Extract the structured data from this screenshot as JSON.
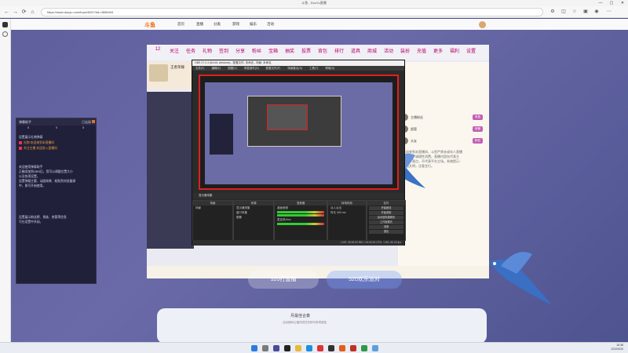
{
  "browser": {
    "window_title": "斗鱼 - DouYu直播",
    "address": "https://www.douyu.com/topic/520/?rid=4608494",
    "nav": {
      "back": "←",
      "forward": "→",
      "reload": "⟳",
      "home": "⌂"
    },
    "window_controls": {
      "min": "—",
      "max": "▢",
      "close": "✕"
    }
  },
  "site": {
    "logo": "斗鱼",
    "nav_items": [
      "首页",
      "直播",
      "分类",
      "游戏",
      "娱乐",
      "活动"
    ],
    "room": {
      "streamer_name": "王者荣耀",
      "room_toolbar": [
        "12",
        "关注",
        "任务",
        "礼物",
        "签到",
        "分享",
        "粉丝",
        "宝箱",
        "抽奖",
        "投票",
        "背包",
        "排行",
        "道具",
        "商城",
        "活动",
        "装扮",
        "充值",
        "更多",
        "福利",
        "设置"
      ],
      "chat_users": [
        {
          "name": "主播粉丝",
          "badge": "贵族"
        },
        {
          "name": "超管",
          "badge": "房管"
        },
        {
          "name": "水友",
          "badge": "粉丝"
        }
      ],
      "chat_text": [
        "欢迎来到本直播间，斗鱼严禁未成年人直播",
        "或打赏，请理性消费。直播内容仅代表主",
        "播个人观点，不代表平台立场。系统提示：",
        "网络文明，注意言行。"
      ]
    },
    "tabs": {
      "tab1": "520打直播",
      "tab2": "520欢乐派对"
    },
    "event": {
      "title": "月最佳合奏",
      "subtitle": "活动期间主播完成任务即可获得奖励"
    }
  },
  "obs": {
    "title": "OBS 27.2.4 (64-bit, windows) - 配置文件: 未命名 - 场景: 未命名",
    "menu": [
      "文件(F)",
      "编辑(E)",
      "视图(V)",
      "停靠部件(D)",
      "配置文件(P)",
      "场景集合(S)",
      "工具(T)",
      "帮助(H)"
    ],
    "scene_bar": "显示器采集",
    "docks": {
      "scenes": {
        "head": "场景",
        "items": [
          "场景"
        ]
      },
      "sources": {
        "head": "来源",
        "items": [
          "显示器采集",
          "窗口采集",
          "图像"
        ]
      },
      "mixer": {
        "head": "混音器",
        "items": [
          "桌面音频",
          "麦克风/Aux"
        ]
      },
      "transitions": {
        "head": "转场特效",
        "items": [
          "淡入淡出",
          "时长 300 ms"
        ]
      },
      "controls": {
        "head": "控件",
        "items": [
          "开始推流",
          "开始录制",
          "启动虚拟摄像机",
          "工作室模式",
          "设置",
          "退出"
        ]
      }
    },
    "status": "LIVE: 00:00:00   REC: 00:00:00   CPU: 1.8%, 60.00 fps"
  },
  "overlay_panel": {
    "title": "弹幕助手",
    "right": "已连接",
    "stats": [
      "0",
      "0",
      "0"
    ],
    "messages": [
      "设置展示礼物弹幕",
      "礼物 欢迎来到本直播间",
      "关注主播 欢迎进入直播间",
      "欢迎使用弹幕助手",
      "正确添加到OBS后，您可以调整位置大小",
      "以及各项设置。",
      "设置弹幕主题、动画效果、粘贴到浏览器源",
      "中，即可开始使用。",
      "设置展示粉丝牌、贵族、房管等信息",
      "可在设置中关闭。"
    ]
  },
  "taskbar": {
    "time": "16:38",
    "date": "2022/5/20"
  }
}
